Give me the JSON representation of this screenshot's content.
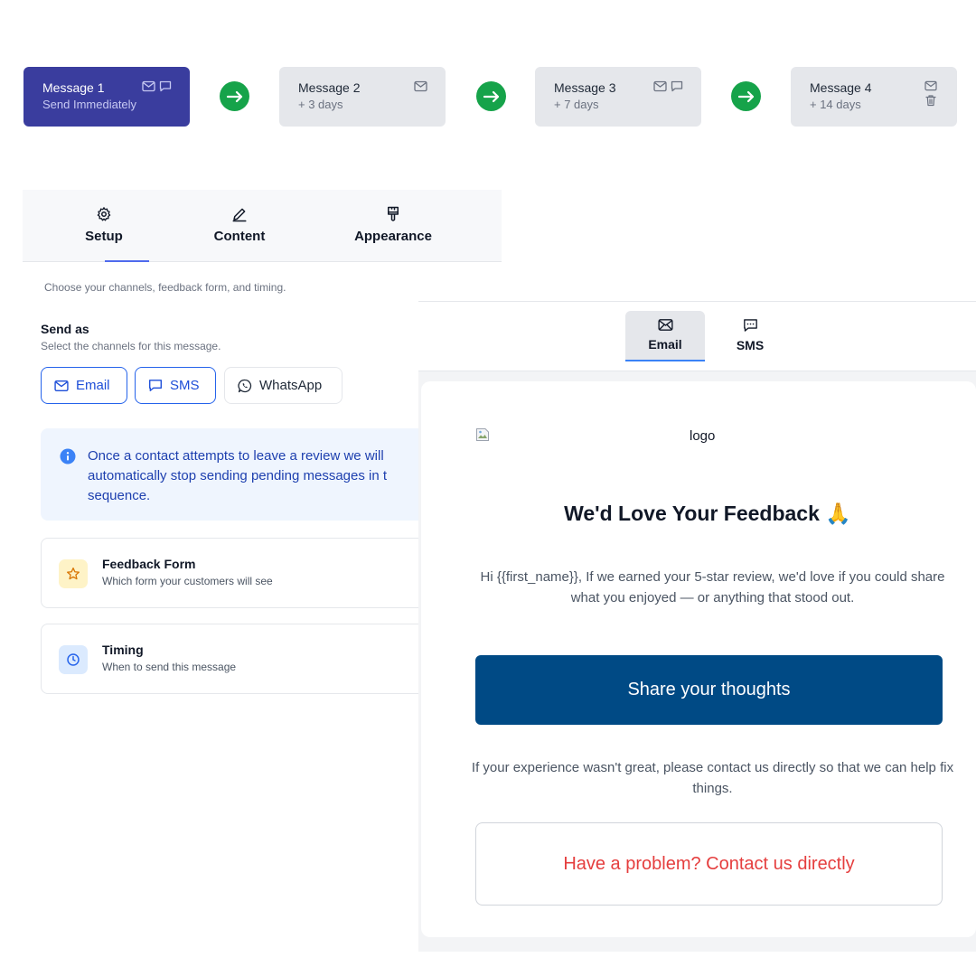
{
  "sequence": [
    {
      "title": "Message 1",
      "subtitle": "Send Immediately",
      "icons": [
        "mail-icon",
        "chat-icon"
      ]
    },
    {
      "title": "Message 2",
      "subtitle": "+ 3 days",
      "icons": [
        "mail-icon"
      ]
    },
    {
      "title": "Message 3",
      "subtitle": "+ 7 days",
      "icons": [
        "mail-icon",
        "chat-icon"
      ]
    },
    {
      "title": "Message 4",
      "subtitle": "+ 14 days",
      "icons": [
        "mail-icon",
        "trash-icon"
      ]
    }
  ],
  "editor_tabs": [
    {
      "label": "Setup",
      "icon": "gear-icon",
      "active": true
    },
    {
      "label": "Content",
      "icon": "pencil-icon"
    },
    {
      "label": "Appearance",
      "icon": "brush-icon"
    }
  ],
  "intro": "Choose your channels, feedback form, and timing.",
  "send_as": {
    "title": "Send as",
    "subtitle": "Select the channels for this message.",
    "channels": [
      {
        "label": "Email",
        "icon": "mail-icon",
        "selected": true
      },
      {
        "label": "SMS",
        "icon": "chat-icon",
        "selected": true
      },
      {
        "label": "WhatsApp",
        "icon": "whatsapp-icon",
        "selected": false
      }
    ]
  },
  "info": {
    "lines": [
      "Once a contact attempts to leave a review we will",
      "automatically stop sending pending messages in t",
      "sequence."
    ]
  },
  "settings": [
    {
      "title": "Feedback Form",
      "subtitle": "Which form your customers will see",
      "icon": "star-icon"
    },
    {
      "title": "Timing",
      "subtitle": "When to send this message",
      "icon": "clock-icon"
    }
  ],
  "preview": {
    "tabs": [
      {
        "label": "Email",
        "icon": "mail-icon",
        "active": true
      },
      {
        "label": "SMS",
        "icon": "chat-icon"
      }
    ],
    "logo_alt": "logo",
    "heading": "We'd Love Your Feedback 🙏",
    "body": "Hi {{first_name}}, If we earned your 5-star review, we'd love if you could share what you enjoyed — or anything that stood out.",
    "primary_button": "Share your thoughts",
    "footer": "If your experience wasn't great, please contact us directly so that we can help fix things.",
    "secondary_button": "Have a problem? Contact us directly"
  },
  "colors": {
    "active_message": "#3a3d9e",
    "arrow": "#16a34a",
    "primary_button": "#004a85",
    "contact_text": "#e53e3e"
  }
}
